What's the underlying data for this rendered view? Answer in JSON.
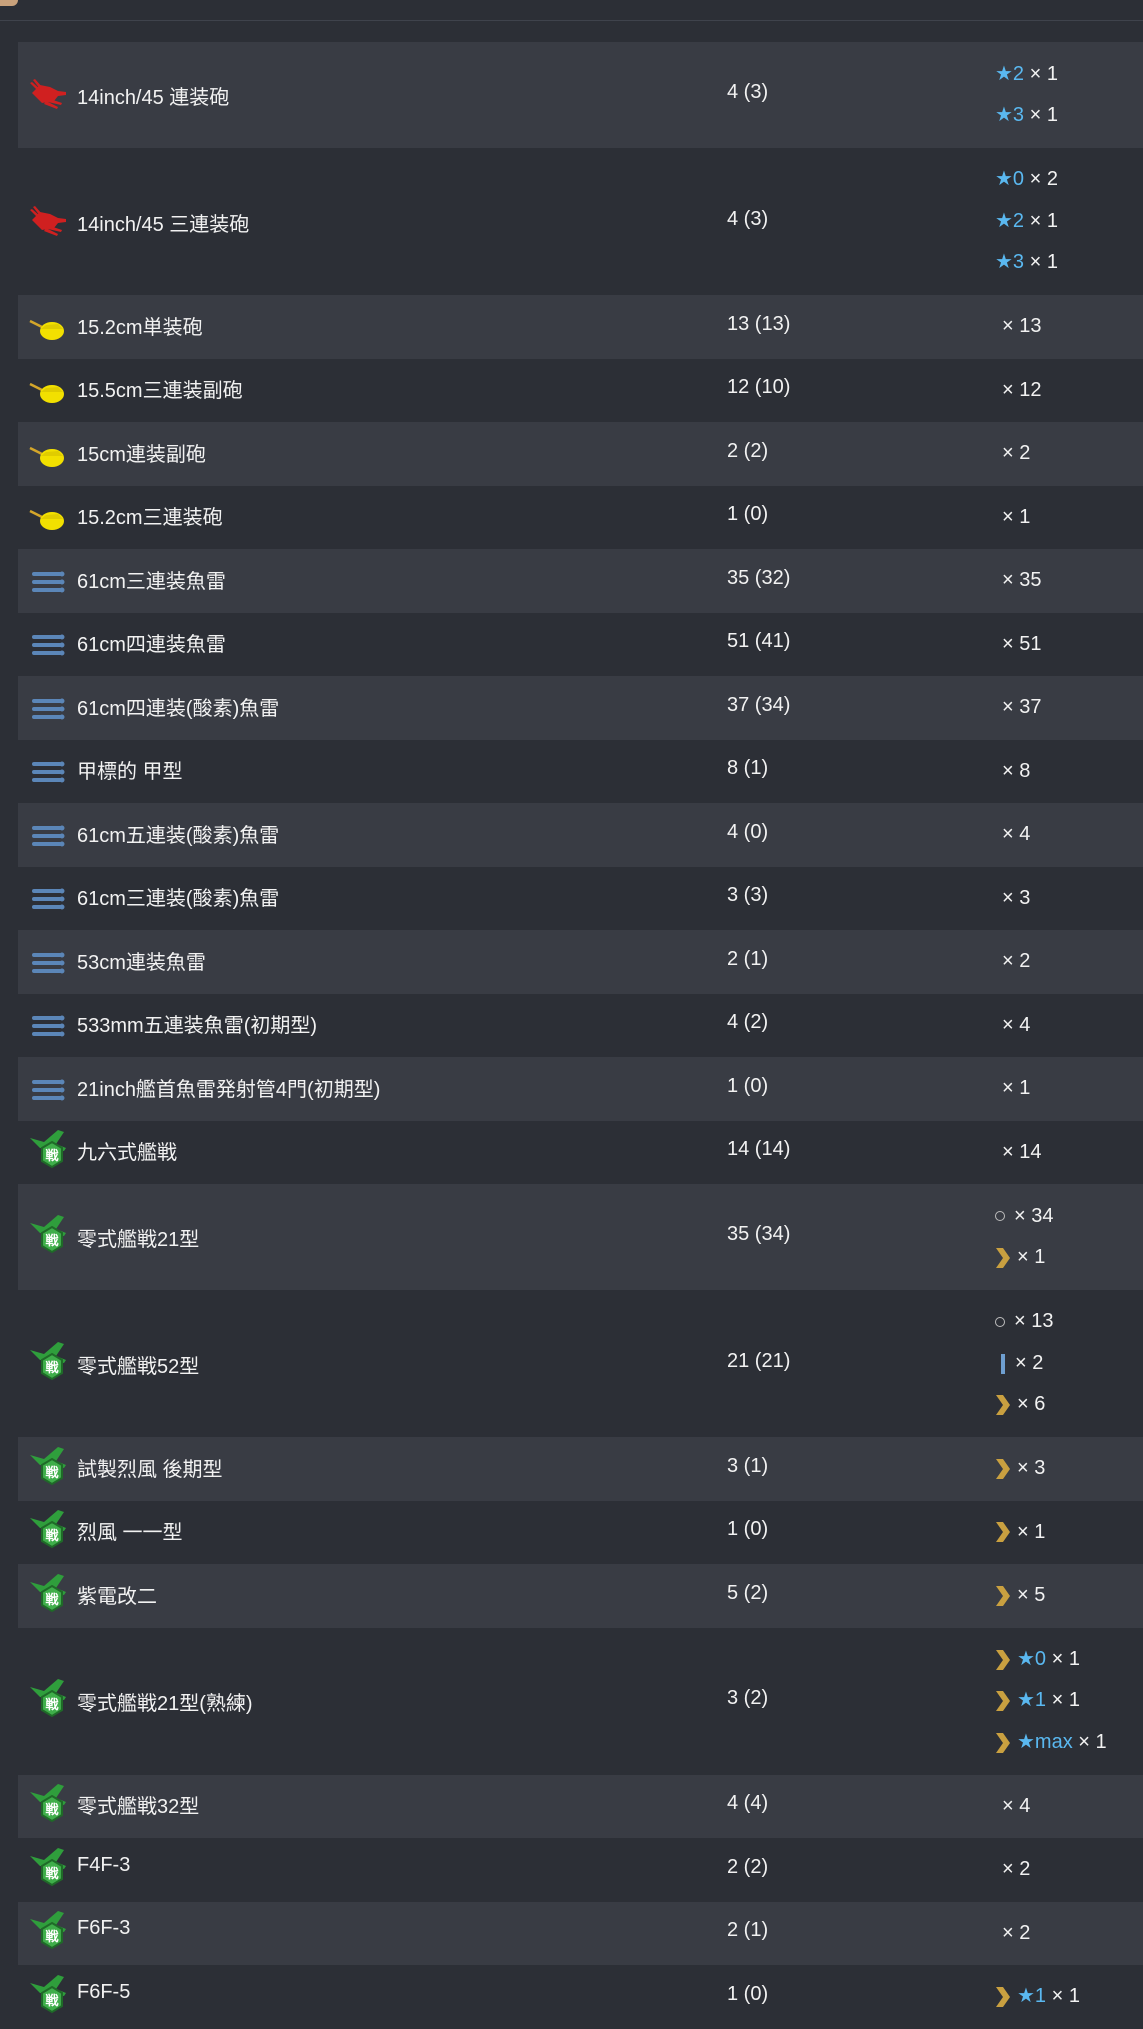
{
  "colors": {
    "background": "#2c2f36",
    "row_alt": "#393c44",
    "text": "#f2f2f2",
    "star": "#5ab8f0",
    "chevron": "#c9a040",
    "main_gun": "#d02020",
    "secondary_gun": "#f2e000",
    "torpedo": "#5b86b8",
    "fighter": "#2f9e3c"
  },
  "equipment": [
    {
      "icon": "main-gun-icon",
      "name": "14inch/45 連装砲",
      "count": "4 (3)",
      "prof": [
        {
          "star": "★2",
          "mult": "× 1"
        },
        {
          "star": "★3",
          "mult": "× 1"
        }
      ]
    },
    {
      "icon": "main-gun-icon",
      "name": "14inch/45 三連装砲",
      "count": "4 (3)",
      "prof": [
        {
          "star": "★0",
          "mult": "× 2"
        },
        {
          "star": "★2",
          "mult": "× 1"
        },
        {
          "star": "★3",
          "mult": "× 1"
        }
      ]
    },
    {
      "icon": "secondary-gun-icon",
      "name": "15.2cm単装砲",
      "count": "13 (13)",
      "prof": [
        {
          "mult": "× 13"
        }
      ]
    },
    {
      "icon": "secondary-gun-icon",
      "name": "15.5cm三連装副砲",
      "count": "12 (10)",
      "prof": [
        {
          "mult": "× 12"
        }
      ]
    },
    {
      "icon": "secondary-gun-icon",
      "name": "15cm連装副砲",
      "count": "2 (2)",
      "prof": [
        {
          "mult": "× 2"
        }
      ]
    },
    {
      "icon": "secondary-gun-icon",
      "name": "15.2cm三連装砲",
      "count": "1 (0)",
      "prof": [
        {
          "mult": "× 1"
        }
      ]
    },
    {
      "icon": "torpedo-icon",
      "name": "61cm三連装魚雷",
      "count": "35 (32)",
      "prof": [
        {
          "mult": "× 35"
        }
      ]
    },
    {
      "icon": "torpedo-icon",
      "name": "61cm四連装魚雷",
      "count": "51 (41)",
      "prof": [
        {
          "mult": "× 51"
        }
      ]
    },
    {
      "icon": "torpedo-icon",
      "name": "61cm四連装(酸素)魚雷",
      "count": "37 (34)",
      "prof": [
        {
          "mult": "× 37"
        }
      ]
    },
    {
      "icon": "torpedo-icon",
      "name": "甲標的 甲型",
      "count": "8 (1)",
      "prof": [
        {
          "mult": "× 8"
        }
      ]
    },
    {
      "icon": "torpedo-icon",
      "name": "61cm五連装(酸素)魚雷",
      "count": "4 (0)",
      "prof": [
        {
          "mult": "× 4"
        }
      ]
    },
    {
      "icon": "torpedo-icon",
      "name": "61cm三連装(酸素)魚雷",
      "count": "3 (3)",
      "prof": [
        {
          "mult": "× 3"
        }
      ]
    },
    {
      "icon": "torpedo-icon",
      "name": "53cm連装魚雷",
      "count": "2 (1)",
      "prof": [
        {
          "mult": "× 2"
        }
      ]
    },
    {
      "icon": "torpedo-icon",
      "name": "533mm五連装魚雷(初期型)",
      "count": "4 (2)",
      "prof": [
        {
          "mult": "× 4"
        }
      ]
    },
    {
      "icon": "torpedo-icon",
      "name": "21inch艦首魚雷発射管4門(初期型)",
      "count": "1 (0)",
      "prof": [
        {
          "mult": "× 1"
        }
      ]
    },
    {
      "icon": "fighter-icon",
      "name": "九六式艦戦",
      "count": "14 (14)",
      "prof": [
        {
          "mult": "× 14"
        }
      ]
    },
    {
      "icon": "fighter-icon",
      "name": "零式艦戦21型",
      "count": "35 (34)",
      "prof": [
        {
          "mark": "circle",
          "mult": "× 34"
        },
        {
          "mark": "chevron",
          "mult": "× 1"
        }
      ]
    },
    {
      "icon": "fighter-icon",
      "name": "零式艦戦52型",
      "count": "21 (21)",
      "prof": [
        {
          "mark": "circle",
          "mult": "× 13"
        },
        {
          "mark": "bar",
          "mult": "× 2"
        },
        {
          "mark": "chevron",
          "mult": "× 6"
        }
      ]
    },
    {
      "icon": "fighter-icon",
      "name": "試製烈風 後期型",
      "count": "3 (1)",
      "prof": [
        {
          "mark": "chevron",
          "mult": "× 3"
        }
      ]
    },
    {
      "icon": "fighter-icon",
      "name": "烈風 一一型",
      "count": "1 (0)",
      "prof": [
        {
          "mark": "chevron",
          "mult": "× 1"
        }
      ]
    },
    {
      "icon": "fighter-icon",
      "name": "紫電改二",
      "count": "5 (2)",
      "prof": [
        {
          "mark": "chevron",
          "mult": "× 5"
        }
      ]
    },
    {
      "icon": "fighter-icon",
      "name": "零式艦戦21型(熟練)",
      "count": "3 (2)",
      "prof": [
        {
          "mark": "chevron",
          "star": "★0",
          "mult": "× 1"
        },
        {
          "mark": "chevron",
          "star": "★1",
          "mult": "× 1"
        },
        {
          "mark": "chevron",
          "star": "★max",
          "mult": "× 1"
        }
      ]
    },
    {
      "icon": "fighter-icon",
      "name": "零式艦戦32型",
      "count": "4 (4)",
      "prof": [
        {
          "mult": "× 4"
        }
      ]
    },
    {
      "icon": "fighter-icon",
      "name": "F4F-3",
      "count": "2 (2)",
      "prof": [
        {
          "mult": "× 2"
        }
      ]
    },
    {
      "icon": "fighter-icon",
      "name": "F6F-3",
      "count": "2 (1)",
      "prof": [
        {
          "mult": "× 2"
        }
      ]
    },
    {
      "icon": "fighter-icon",
      "name": "F6F-5",
      "count": "1 (0)",
      "prof": [
        {
          "mark": "chevron",
          "star": "★1",
          "mult": "× 1"
        }
      ]
    }
  ]
}
